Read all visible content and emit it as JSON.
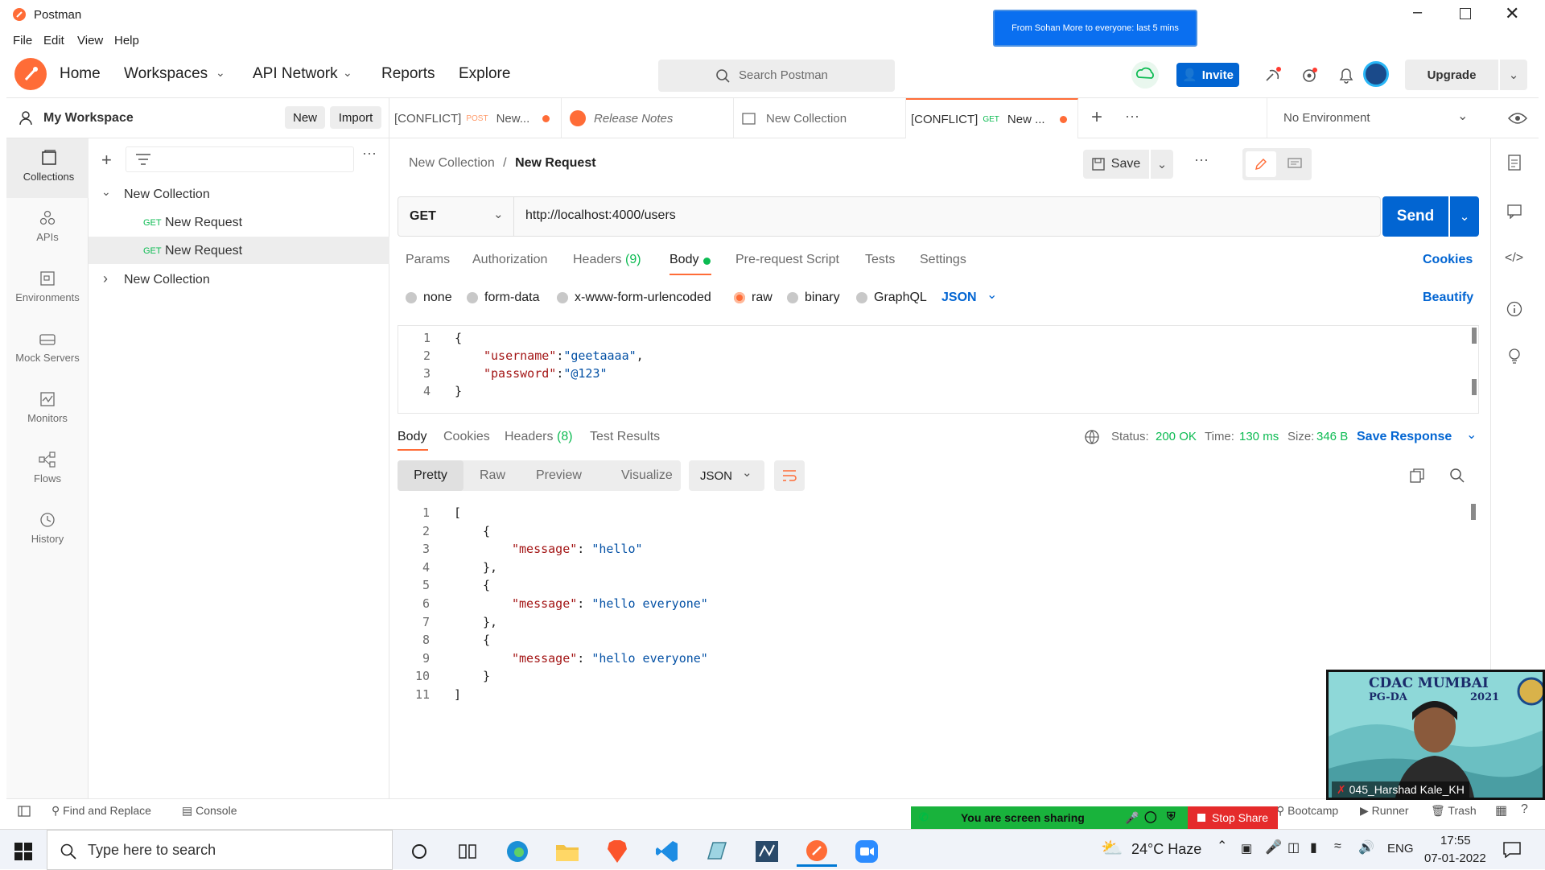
{
  "window": {
    "title": "Postman"
  },
  "menu": [
    "File",
    "Edit",
    "View",
    "Help"
  ],
  "notification": {
    "text": "From Sohan More to everyone: last 5 mins"
  },
  "header": {
    "nav": [
      "Home",
      "Workspaces",
      "API Network",
      "Reports",
      "Explore"
    ],
    "search_placeholder": "Search Postman",
    "invite_label": "Invite",
    "upgrade_label": "Upgrade"
  },
  "workspace": {
    "name": "My Workspace",
    "new_label": "New",
    "import_label": "Import"
  },
  "rail": [
    "Collections",
    "APIs",
    "Environments",
    "Mock Servers",
    "Monitors",
    "Flows",
    "History"
  ],
  "tree": {
    "collection1": "New Collection",
    "requests": [
      {
        "method": "GET",
        "name": "New Request"
      },
      {
        "method": "GET",
        "name": "New Request"
      }
    ],
    "collection2": "New Collection"
  },
  "tabs": [
    {
      "conflict": "[CONFLICT]",
      "method": "POST",
      "name": "New..."
    },
    {
      "name": "Release Notes"
    },
    {
      "name": "New Collection"
    },
    {
      "conflict": "[CONFLICT]",
      "method": "GET",
      "name": "New ..."
    }
  ],
  "environment": "No Environment",
  "breadcrumb": {
    "parent": "New Collection",
    "sep": "/",
    "current": "New Request"
  },
  "save_label": "Save",
  "request": {
    "method": "GET",
    "url": "http://localhost:4000/users",
    "send_label": "Send",
    "tabs": [
      "Params",
      "Authorization",
      "Headers",
      "(9)",
      "Body",
      "Pre-request Script",
      "Tests",
      "Settings"
    ],
    "cookies_label": "Cookies",
    "body_types": [
      "none",
      "form-data",
      "x-www-form-urlencoded",
      "raw",
      "binary",
      "GraphQL"
    ],
    "format": "JSON",
    "beautify_label": "Beautify",
    "body_lines": [
      {
        "n": "1",
        "text": "{"
      },
      {
        "n": "2",
        "key": "\"username\"",
        "sep": ":",
        "val": "\"geetaaaa\"",
        "tail": ","
      },
      {
        "n": "3",
        "key": "\"password\"",
        "sep": ":",
        "val": "\"@123\"",
        "tail": ""
      },
      {
        "n": "4",
        "text": "}"
      }
    ]
  },
  "response": {
    "tabs": [
      "Body",
      "Cookies",
      "Headers",
      "(8)",
      "Test Results"
    ],
    "status_label": "Status:",
    "status": "200 OK",
    "time_label": "Time:",
    "time": "130 ms",
    "size_label": "Size:",
    "size": "346 B",
    "save_label": "Save Response",
    "views": [
      "Pretty",
      "Raw",
      "Preview",
      "Visualize"
    ],
    "format": "JSON",
    "lines": [
      {
        "n": "1",
        "text": "["
      },
      {
        "n": "2",
        "text": "{"
      },
      {
        "n": "3",
        "key": "\"message\"",
        "val": "\"hello\""
      },
      {
        "n": "4",
        "text": "},"
      },
      {
        "n": "5",
        "text": "{"
      },
      {
        "n": "6",
        "key": "\"message\"",
        "val": "\"hello everyone\""
      },
      {
        "n": "7",
        "text": "},"
      },
      {
        "n": "8",
        "text": "{"
      },
      {
        "n": "9",
        "key": "\"message\"",
        "val": "\"hello everyone\""
      },
      {
        "n": "10",
        "text": "}"
      },
      {
        "n": "11",
        "text": "]"
      }
    ]
  },
  "footer": {
    "find_replace": "Find and Replace",
    "console": "Console",
    "sharing_text": "You are screen sharing",
    "stop_share": "Stop Share",
    "bootcamp": "Bootcamp",
    "runner": "Runner",
    "trash": "Trash"
  },
  "video": {
    "banner": "CDAC MUMBAI",
    "banner2": "PG-DA",
    "year": "2021",
    "participant": "045_Harshad Kale_KH"
  },
  "taskbar": {
    "search_placeholder": "Type here to search",
    "weather": "24°C  Haze",
    "lang": "ENG",
    "time": "17:55",
    "date": "07-01-2022"
  },
  "colors": {
    "orange": "#ff6c37",
    "blue": "#0265d2",
    "green": "#0cbb52",
    "zoom_green": "#19b33c",
    "stop_red": "#e52b2b"
  }
}
